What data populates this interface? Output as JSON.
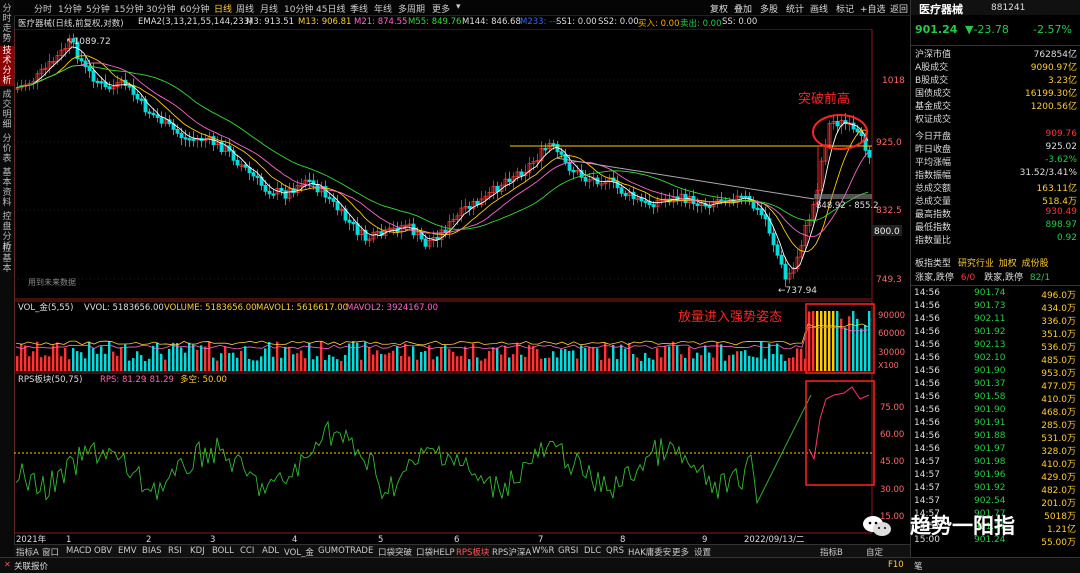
{
  "left_tabs": [
    "分时走势",
    "技术分析",
    "成交明细",
    "分价表",
    "基本资料",
    "控盘分析",
    "控基本"
  ],
  "left_tab_active": 1,
  "period_tabs": [
    "分时",
    "1分钟",
    "5分钟",
    "15分钟",
    "30分钟",
    "60分钟",
    "日线",
    "周线",
    "月线",
    "10分钟",
    "45日线",
    "季线",
    "年线",
    "多周期",
    "更多"
  ],
  "period_active": 6,
  "toolbar_buttons": [
    "复权",
    "叠加",
    "多股",
    "统计",
    "画线",
    "标记",
    "+自选",
    "返回"
  ],
  "legend": {
    "name": "医疗器械(日线,前复权,对数)",
    "ema": "EMA2(3,13,21,55,144,233)",
    "m3": "M3: 913.51",
    "m13": "M13: 906.81",
    "m21": "M21: 874.55",
    "m55": "M55: 849.76",
    "m144": "M144: 846.68",
    "m233": "M233: ---",
    "ss1": "SS1: 0.00",
    "ss2": "SS2: 0.00",
    "buy": "买入: 0.00",
    "sell": "卖出: 0.00",
    "ss": "SS: 0.00"
  },
  "price_axis": [
    "1018",
    "925.0",
    "832.5",
    "800.0",
    "749.3"
  ],
  "annotations": {
    "high": "1089.72",
    "low": "737.94",
    "range": "848.92 - 855.2",
    "breakout": "突破前高",
    "volume_note": "放量进入强势姿态",
    "future_data": "用到未来数据"
  },
  "volume_legend": {
    "title": "VOL_金(5,55)",
    "vvol": "VVOL: 5183656.00",
    "volume": "VOLUME: 5183656.00",
    "mavol1": "MAVOL1: 5616617.00",
    "mavol2": "MAVOL2: 3924167.00"
  },
  "volume_axis": [
    "90000",
    "60000",
    "30000",
    "X100"
  ],
  "rps_legend": {
    "title": "RPS板块(50,75)",
    "rps": "RPS: 81.29",
    "val": ": 81.29",
    "duokong": "多空: 50.00"
  },
  "rps_axis": [
    "75.00",
    "60.00",
    "45.00",
    "30.00",
    "15.00"
  ],
  "date_axis": {
    "year": "2021年",
    "months": [
      "1",
      "2",
      "3",
      "4",
      "5",
      "6",
      "7",
      "8",
      "9"
    ],
    "current": "2022/09/13/二"
  },
  "indicator_tabs": [
    "指标A",
    "窗口",
    "MACD",
    "OBV",
    "EMV",
    "BIAS",
    "RSI",
    "KDJ",
    "BOLL",
    "CCI",
    "ADL",
    "VOL_金",
    "GUMOTRADE",
    "口袋突破",
    "口袋HELP",
    "RPS板块",
    "RPS沪深A",
    "W%R",
    "GRSI",
    "DLC",
    "QRS",
    "HAK庸委安",
    "更多",
    "设置",
    "指标B",
    "自定"
  ],
  "indicator_active": 15,
  "quote": {
    "name": "医疗器械",
    "code": "881241",
    "price": "901.24",
    "change": "▼-23.78",
    "pct": "-2.57%",
    "rows": [
      {
        "label": "沪深市值",
        "value": "762854亿",
        "color": "#dddddd"
      },
      {
        "label": "A股成交",
        "value": "9090.97亿",
        "color": "#ffcc33"
      },
      {
        "label": "B股成交",
        "value": "3.23亿",
        "color": "#ffcc33"
      },
      {
        "label": "国债成交",
        "value": "16199.30亿",
        "color": "#ffcc33"
      },
      {
        "label": "基金成交",
        "value": "1200.56亿",
        "color": "#ffcc33"
      },
      {
        "label": "权证成交",
        "value": "",
        "color": "#ffcc33"
      },
      {
        "label": "今日开盘",
        "value": "909.76",
        "color": "#ff3333"
      },
      {
        "label": "昨日收盘",
        "value": "925.02",
        "color": "#dddddd"
      },
      {
        "label": "平均涨幅",
        "value": "-3.62%",
        "color": "#22cc44"
      },
      {
        "label": "指数振幅",
        "value": "31.52/3.41%",
        "color": "#dddddd"
      },
      {
        "label": "总成交额",
        "value": "163.11亿",
        "color": "#ffcc33"
      },
      {
        "label": "总成交量",
        "value": "518.4万",
        "color": "#ffcc33"
      },
      {
        "label": "最高指数",
        "value": "930.49",
        "color": "#ff3333"
      },
      {
        "label": "最低指数",
        "value": "898.97",
        "color": "#22cc44"
      },
      {
        "label": "指数量比",
        "value": "0.92",
        "color": "#22cc44"
      }
    ],
    "board_label": "板指类型",
    "board_values": [
      "研究行业",
      "加权",
      "成份股"
    ],
    "updown_label": "涨家,跌停",
    "updown_val": "6/0",
    "downup_label": "跌家,跌停",
    "downup_val": "82/1"
  },
  "ticks": [
    {
      "t": "14:56",
      "p": "901.74",
      "v": "496.0万"
    },
    {
      "t": "14:56",
      "p": "901.73",
      "v": "434.0万"
    },
    {
      "t": "14:56",
      "p": "902.11",
      "v": "336.0万"
    },
    {
      "t": "14:56",
      "p": "901.92",
      "v": "351.0万"
    },
    {
      "t": "14:56",
      "p": "902.13",
      "v": "536.0万"
    },
    {
      "t": "14:56",
      "p": "902.10",
      "v": "485.0万"
    },
    {
      "t": "14:56",
      "p": "901.90",
      "v": "953.0万"
    },
    {
      "t": "14:56",
      "p": "901.37",
      "v": "477.0万"
    },
    {
      "t": "14:56",
      "p": "901.58",
      "v": "410.0万"
    },
    {
      "t": "14:56",
      "p": "901.90",
      "v": "468.0万"
    },
    {
      "t": "14:56",
      "p": "901.91",
      "v": "285.0万"
    },
    {
      "t": "14:56",
      "p": "901.88",
      "v": "531.0万"
    },
    {
      "t": "14:56",
      "p": "901.97",
      "v": "328.0万"
    },
    {
      "t": "14:57",
      "p": "901.98",
      "v": "410.0万"
    },
    {
      "t": "14:57",
      "p": "901.96",
      "v": "429.0万"
    },
    {
      "t": "14:57",
      "p": "901.92",
      "v": "482.0万"
    },
    {
      "t": "14:57",
      "p": "902.54",
      "v": "201.0万"
    },
    {
      "t": "14:57",
      "p": "901.77",
      "v": "5018万"
    },
    {
      "t": "14:57",
      "p": "901.77",
      "v": "1.21亿"
    },
    {
      "t": "15:00",
      "p": "901.24",
      "v": "55.00万"
    }
  ],
  "watermark": "趋势一阳指",
  "status": "关联报价",
  "status_right": "F10",
  "status_right2": "笔",
  "colors": {
    "up": "#ff3333",
    "down": "#00dddd",
    "ma_yellow": "#ffcc00",
    "accent_red": "#ff2222",
    "rps_green": "#33bb33",
    "rps_pink": "#ff66aa"
  }
}
